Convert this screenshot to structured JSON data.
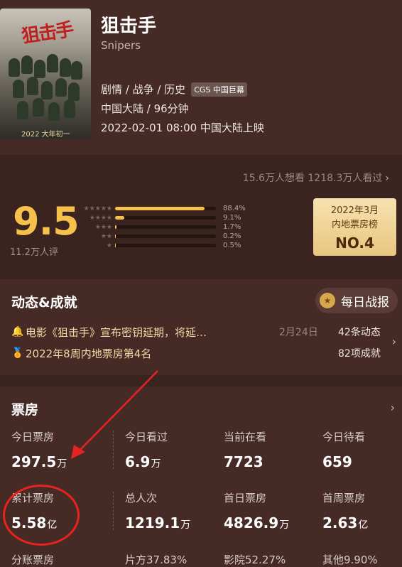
{
  "movie": {
    "title": "狙击手",
    "subtitle": "Snipers",
    "genres": "剧情 / 战争 / 历史",
    "format_tag": "CGS 中国巨幕",
    "region_runtime": "中国大陆 / 96分钟",
    "release": "2022-02-01 08:00 中国大陆上映",
    "poster": {
      "title": "狙击手",
      "caption": "2022 大年初一"
    }
  },
  "rating": {
    "wants_watched": "15.6万人想看  1218.3万人看过",
    "score": "9.5",
    "count": "11.2万人评",
    "distribution": [
      {
        "stars": "★★★★★",
        "pct_label": "88.4%",
        "value": 0.884
      },
      {
        "stars": "★★★★",
        "pct_label": "9.1%",
        "value": 0.091
      },
      {
        "stars": "★★★",
        "pct_label": "1.7%",
        "value": 0.017
      },
      {
        "stars": "★★",
        "pct_label": "0.2%",
        "value": 0.002
      },
      {
        "stars": "★",
        "pct_label": "0.5%",
        "value": 0.005
      }
    ],
    "rank_card": {
      "line1": "2022年3月",
      "line2": "内地票房榜",
      "rank": "NO.4"
    }
  },
  "dynamics": {
    "title": "动态&成就",
    "daily_button": "每日战报",
    "rows": [
      {
        "text": "电影《狙击手》宣布密钥延期，将延…",
        "date": "2月24日",
        "count": "42条动态"
      },
      {
        "text": "2022年8周内地票房第4名",
        "date": "",
        "count": "82项成就"
      }
    ]
  },
  "box_office": {
    "title": "票房",
    "cells": [
      {
        "label": "今日票房",
        "value": "297.5",
        "unit": "万"
      },
      {
        "label": "今日看过",
        "value": "6.9",
        "unit": "万"
      },
      {
        "label": "当前在看",
        "value": "7723",
        "unit": ""
      },
      {
        "label": "今日待看",
        "value": "659",
        "unit": ""
      },
      {
        "label": "累计票房",
        "value": "5.58",
        "unit": "亿"
      },
      {
        "label": "总人次",
        "value": "1219.1",
        "unit": "万"
      },
      {
        "label": "首日票房",
        "value": "4826.9",
        "unit": "万"
      },
      {
        "label": "首周票房",
        "value": "2.63",
        "unit": "亿"
      }
    ],
    "split": [
      {
        "label": "分账票房"
      },
      {
        "label": "片方37.83%"
      },
      {
        "label": "影院52.27%"
      },
      {
        "label": "其他9.90%"
      }
    ]
  },
  "colors": {
    "accent": "#f5c14a",
    "background": "#3a2420",
    "annotation": "#e8231f"
  },
  "icons": [
    "bell-icon",
    "medal-icon",
    "chevron-right-icon"
  ]
}
